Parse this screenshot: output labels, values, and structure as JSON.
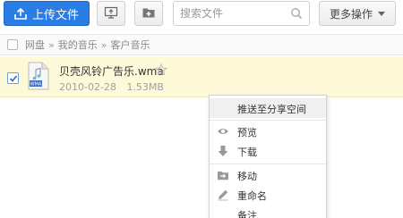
{
  "toolbar": {
    "upload_label": "上传文件",
    "search_placeholder": "搜索文件",
    "more_label": "更多操作"
  },
  "breadcrumb": {
    "items": [
      "网盘",
      "我的音乐",
      "客户音乐"
    ],
    "separator": "»"
  },
  "file": {
    "name": "贝壳风铃广告乐.wma",
    "date": "2010-02-28",
    "size": "1.53MB",
    "type_badge": "WMA"
  },
  "context_menu": {
    "items": [
      {
        "label": "推送至分享空间",
        "icon": ""
      },
      {
        "label": "预览",
        "icon": "eye-icon"
      },
      {
        "label": "下载",
        "icon": "download-arrow-icon"
      },
      {
        "label": "移动",
        "icon": "move-folder-icon"
      },
      {
        "label": "重命名",
        "icon": "pencil-icon"
      },
      {
        "label": "备注",
        "icon": ""
      }
    ]
  },
  "colors": {
    "primary_button": "#2b7de6",
    "selected_row": "#fef9d9"
  }
}
